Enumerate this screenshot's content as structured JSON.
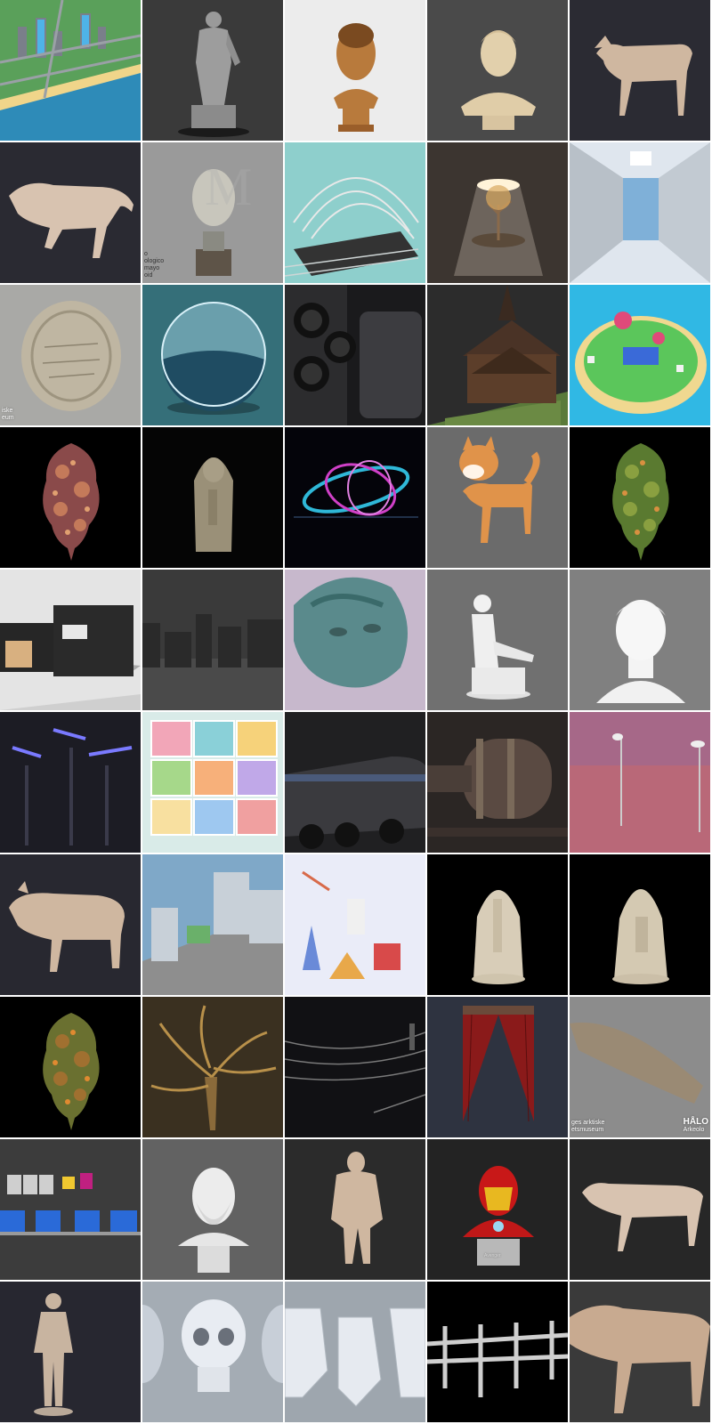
{
  "gallery": {
    "tiles": [
      {
        "name": "low-poly-city-beach-thumbnail",
        "bg": "#2f8fb8",
        "subject": "city"
      },
      {
        "name": "hercules-statue-thumbnail",
        "bg": "#3a3a3a",
        "subject": "statue"
      },
      {
        "name": "bronze-bust-thumbnail",
        "bg": "#ececec",
        "subject": "bronze-bust"
      },
      {
        "name": "classical-bust-thumbnail",
        "bg": "#4a4a4a",
        "subject": "bust"
      },
      {
        "name": "dog-anatomy-thumbnail",
        "bg": "#2b2b33",
        "subject": "dog"
      },
      {
        "name": "lioness-anatomy-thumbnail",
        "bg": "#2a2a32",
        "subject": "feline"
      },
      {
        "name": "roman-head-thumbnail",
        "bg": "#9a9a9a",
        "subject": "head"
      },
      {
        "name": "stage-truss-thumbnail",
        "bg": "#8ecfcc",
        "subject": "stage"
      },
      {
        "name": "light-room-tree-thumbnail",
        "bg": "#3c3530",
        "subject": "light-room"
      },
      {
        "name": "futuristic-interior-thumbnail",
        "bg": "#cfd8e0",
        "subject": "interior"
      },
      {
        "name": "ancient-coin-thumbnail",
        "bg": "#a9a9a6",
        "subject": "coin"
      },
      {
        "name": "glass-sphere-ocean-thumbnail",
        "bg": "#356f79",
        "subject": "sphere"
      },
      {
        "name": "smartphone-camera-thumbnail",
        "bg": "#1a1a1c",
        "subject": "phone"
      },
      {
        "name": "stave-church-thumbnail",
        "bg": "#2c2c2c",
        "subject": "church"
      },
      {
        "name": "cartoon-island-thumbnail",
        "bg": "#2fb7e3",
        "subject": "island"
      },
      {
        "name": "cannabis-bud-purple-thumbnail",
        "bg": "#000000",
        "subject": "bud-purple"
      },
      {
        "name": "chess-piece-warden-thumbnail",
        "bg": "#050505",
        "subject": "chess-warden"
      },
      {
        "name": "neon-light-swirl-thumbnail",
        "bg": "#04040a",
        "subject": "swirl"
      },
      {
        "name": "shiba-inu-dog-thumbnail",
        "bg": "#6b6b6b",
        "subject": "shiba"
      },
      {
        "name": "cannabis-bud-green-thumbnail",
        "bg": "#000000",
        "subject": "bud-green"
      },
      {
        "name": "modern-black-house-thumbnail",
        "bg": "#e4e4e4",
        "subject": "house"
      },
      {
        "name": "city-skyline-grey-thumbnail",
        "bg": "#3a3a3a",
        "subject": "skyline"
      },
      {
        "name": "bronze-head-patina-thumbnail",
        "bg": "#c7b8cc",
        "subject": "patina-head"
      },
      {
        "name": "seated-marble-statue-thumbnail",
        "bg": "#707070",
        "subject": "seated-statue"
      },
      {
        "name": "white-bust-thumbnail",
        "bg": "#808080",
        "subject": "white-bust"
      },
      {
        "name": "scifi-street-lamps-thumbnail",
        "bg": "#1c1c24",
        "subject": "lamps"
      },
      {
        "name": "isometric-rooms-thumbnail",
        "bg": "#d9ebe8",
        "subject": "rooms"
      },
      {
        "name": "police-armored-truck-thumbnail",
        "bg": "#202022",
        "subject": "truck"
      },
      {
        "name": "reactor-engine-thumbnail",
        "bg": "#2b2624",
        "subject": "engine"
      },
      {
        "name": "pink-street-lamp-thumbnail",
        "bg": "#b05a6a",
        "subject": "pink-lamp"
      },
      {
        "name": "pig-anatomy-thumbnail",
        "bg": "#282830",
        "subject": "pig"
      },
      {
        "name": "isometric-city-block-thumbnail",
        "bg": "#6f9fbf",
        "subject": "city-block"
      },
      {
        "name": "world-landmarks-thumbnail",
        "bg": "#e9ecf7",
        "subject": "landmarks"
      },
      {
        "name": "chess-king-horn-thumbnail",
        "bg": "#000000",
        "subject": "chess-king"
      },
      {
        "name": "chess-bishop-thumbnail",
        "bg": "#000000",
        "subject": "chess-bishop"
      },
      {
        "name": "cannabis-bud-orange-thumbnail",
        "bg": "#000000",
        "subject": "bud-orange"
      },
      {
        "name": "dead-tree-thumbnail",
        "bg": "#3a3020",
        "subject": "tree"
      },
      {
        "name": "power-lines-thumbnail",
        "bg": "#111114",
        "subject": "wires"
      },
      {
        "name": "theatre-curtain-thumbnail",
        "bg": "#2e3340",
        "subject": "curtain"
      },
      {
        "name": "stone-blade-artifact-thumbnail",
        "bg": "#8c8c8c",
        "subject": "blade"
      },
      {
        "name": "apple-devices-thumbnail",
        "bg": "#3c3c3c",
        "subject": "devices"
      },
      {
        "name": "bearded-bust-thumbnail",
        "bg": "#626262",
        "subject": "bearded-bust"
      },
      {
        "name": "ape-anatomy-thumbnail",
        "bg": "#2b2b2b",
        "subject": "ape"
      },
      {
        "name": "iron-man-bust-thumbnail",
        "bg": "#232323",
        "subject": "ironman"
      },
      {
        "name": "cheetah-anatomy-thumbnail",
        "bg": "#272727",
        "subject": "cheetah"
      },
      {
        "name": "human-anatomy-figure-thumbnail",
        "bg": "#272730",
        "subject": "human"
      },
      {
        "name": "skulls-thumbnail",
        "bg": "#a4acb4",
        "subject": "skulls"
      },
      {
        "name": "planar-heads-thumbnail",
        "bg": "#9ea6ae",
        "subject": "planar-heads"
      },
      {
        "name": "metal-pipes-thumbnail",
        "bg": "#000000",
        "subject": "pipes"
      },
      {
        "name": "big-cat-anatomy-thumbnail",
        "bg": "#3a3a3a",
        "subject": "bigcat"
      }
    ],
    "overlays": {
      "roman_head": [
        "o",
        "ologico",
        "mayo",
        "oid"
      ],
      "coin": [
        "iske",
        "eum"
      ],
      "blade_left": [
        "ges arktiske",
        "etsmuseum"
      ],
      "blade_brand": "HÅLO",
      "blade_sub": "Arkeolo",
      "ironman_brand": "Avenger"
    }
  }
}
